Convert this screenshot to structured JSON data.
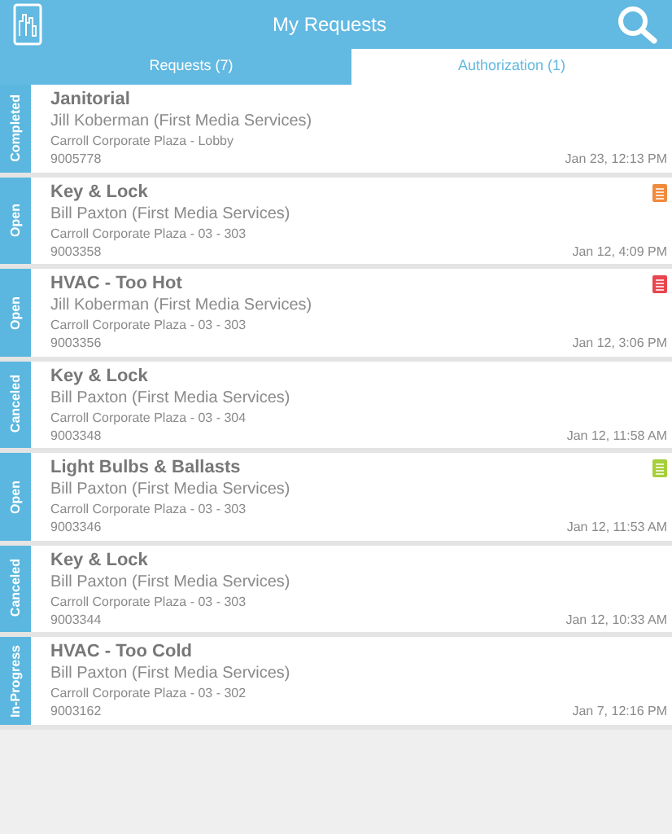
{
  "header": {
    "title": "My Requests"
  },
  "tabs": [
    {
      "label": "Requests (7)",
      "selected": true
    },
    {
      "label": "Authorization (1)",
      "selected": false
    }
  ],
  "requests": [
    {
      "status": "Completed",
      "title": "Janitorial",
      "requester": "Jill Koberman (First Media Services)",
      "location": "Carroll Corporate Plaza - Lobby",
      "number": "9005778",
      "date": "Jan 23, 12:13 PM"
    },
    {
      "status": "Open",
      "title": "Key & Lock",
      "requester": "Bill Paxton (First Media Services)",
      "location": "Carroll Corporate Plaza - 03 - 303",
      "number": "9003358",
      "date": "Jan 12, 4:09 PM",
      "color": "#f08a3c"
    },
    {
      "status": "Open",
      "title": "HVAC - Too Hot",
      "requester": "Jill Koberman (First Media Services)",
      "location": "Carroll Corporate Plaza - 03 - 303",
      "number": "9003356",
      "date": "Jan 12, 3:06 PM",
      "color": "#e8464f"
    },
    {
      "status": "Canceled",
      "title": "Key & Lock",
      "requester": "Bill Paxton (First Media Services)",
      "location": "Carroll Corporate Plaza - 03 - 304",
      "number": "9003348",
      "date": "Jan 12, 11:58 AM"
    },
    {
      "status": "Open",
      "title": "Light Bulbs & Ballasts",
      "requester": "Bill Paxton (First Media Services)",
      "location": "Carroll Corporate Plaza - 03 - 303",
      "number": "9003346",
      "date": "Jan 12, 11:53 AM",
      "color": "#a6cf3a"
    },
    {
      "status": "Canceled",
      "title": "Key & Lock",
      "requester": "Bill Paxton (First Media Services)",
      "location": "Carroll Corporate Plaza - 03 - 303",
      "number": "9003344",
      "date": "Jan 12, 10:33 AM"
    },
    {
      "status": "In-Progress",
      "title": "HVAC - Too Cold",
      "requester": "Bill Paxton (First Media Services)",
      "location": "Carroll Corporate Plaza - 03 - 302",
      "number": "9003162",
      "date": "Jan 7, 12:16 PM"
    }
  ]
}
